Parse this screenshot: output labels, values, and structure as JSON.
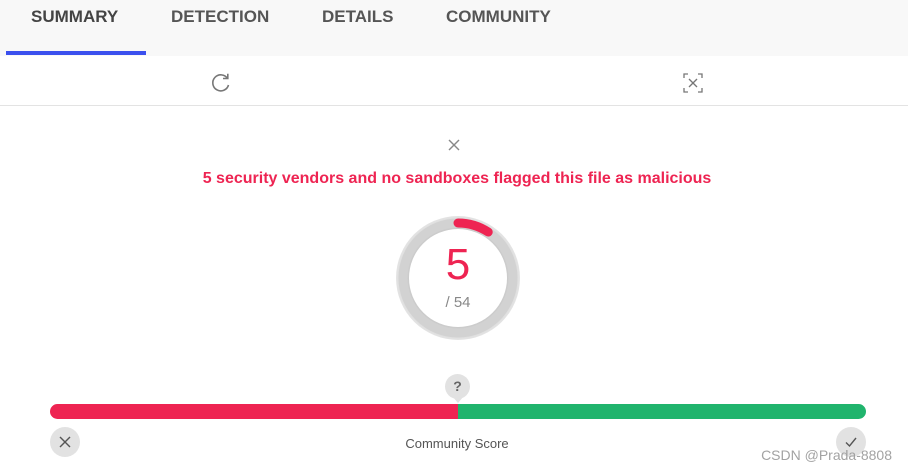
{
  "tabs": [
    {
      "label": "SUMMARY",
      "active": true
    },
    {
      "label": "DETECTION",
      "active": false
    },
    {
      "label": "DETAILS",
      "active": false
    },
    {
      "label": "COMMUNITY",
      "active": false
    }
  ],
  "toolbar": {
    "icons": [
      "refresh-icon",
      "fullscreen-icon"
    ]
  },
  "alert": {
    "headline": "5 security vendors and no sandboxes flagged this file as malicious"
  },
  "detection": {
    "flagged": "5",
    "total_label": "/ 54",
    "flagged_count": 5,
    "total_count": 54
  },
  "community": {
    "help_label": "?",
    "score_label": "Community Score",
    "negative_fraction": 0.5
  },
  "watermark": "CSDN @Prada-8808",
  "colors": {
    "accent": "#3b50ee",
    "malicious": "#ee2452",
    "harmless": "#20b46d"
  }
}
